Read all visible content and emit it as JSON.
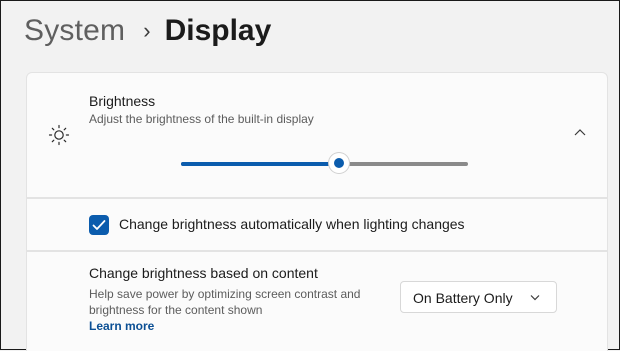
{
  "breadcrumb": {
    "parent": "System",
    "separator": "›",
    "current": "Display"
  },
  "brightness": {
    "title": "Brightness",
    "description": "Adjust the brightness of the built-in display",
    "icon": "sun-icon",
    "collapse_icon": "chevron-up-icon",
    "level_fraction": 0.55,
    "accent_color": "#0b5cad"
  },
  "auto_brightness": {
    "label": "Change brightness automatically when lighting changes",
    "checked": true
  },
  "content_brightness": {
    "title": "Change brightness based on content",
    "description": "Help save power by optimizing screen contrast and brightness for the content shown",
    "link": "Learn more",
    "dropdown_value": "On Battery Only",
    "dropdown_icon": "chevron-down-icon"
  }
}
